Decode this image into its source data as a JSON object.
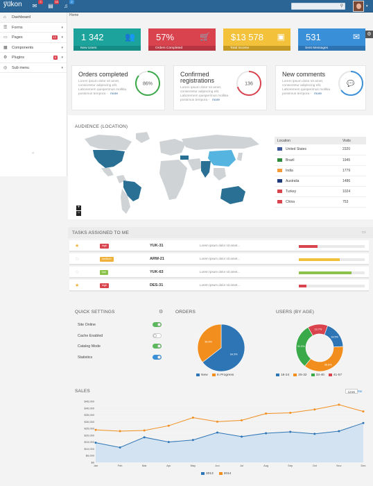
{
  "app": {
    "logo": "yukon",
    "logo_small": "admin"
  },
  "topbar": {
    "mail_badge": "3",
    "messages_badge": "18",
    "alerts_badge": "2"
  },
  "sidebar": {
    "items": [
      {
        "label": "Dashboard",
        "icon": "dashboard-icon"
      },
      {
        "label": "Forms",
        "icon": "forms-icon"
      },
      {
        "label": "Pages",
        "icon": "pages-icon",
        "badge": "12"
      },
      {
        "label": "Components",
        "icon": "components-icon"
      },
      {
        "label": "Plugins",
        "icon": "plugins-icon",
        "badge": "8"
      },
      {
        "label": "Sub menu",
        "icon": "submenu-icon"
      }
    ]
  },
  "breadcrumb": "Home",
  "stats": [
    {
      "value": "1 342",
      "label": "New Users",
      "color": "#1ba39c",
      "dark": "#168c86"
    },
    {
      "value": "57%",
      "label": "Orders Completed",
      "color": "#d9434e",
      "dark": "#b73540"
    },
    {
      "value": "$13 578",
      "label": "Total Income",
      "color": "#f3c13a",
      "dark": "#c59a24"
    },
    {
      "value": "531",
      "label": "Sent Messages",
      "color": "#3a8fd9",
      "dark": "#2e73b1"
    }
  ],
  "info_boxes": [
    {
      "title_1": "Orders completed",
      "title_2": "",
      "gauge": "86%",
      "percent": 86,
      "color": "#3aa94a",
      "desc_1": "Lorem ipsum dolor sit amet,",
      "desc_2": "consectetur adipiscing elit.",
      "desc_3": "Laboremem quisperimus mollitia",
      "desc_4": "possimus tempora -",
      "more": "more"
    },
    {
      "title_1": "Confirmed",
      "title_2": "registrations",
      "gauge": "136",
      "percent": 70,
      "color": "#d9434e",
      "desc_1": "Lorem ipsum dolor sit amet,",
      "desc_2": "consectetur adipiscing elit.",
      "desc_3": "Laboremem quisperimus mollitia",
      "desc_4": "possimus tempora -",
      "more": "more"
    },
    {
      "title_1": "New comments",
      "title_2": "",
      "gauge": "",
      "percent": 65,
      "color": "#3a8fd9",
      "desc_1": "Lorem ipsum dolor sit amet,",
      "desc_2": "consectetur adipiscing elit.",
      "desc_3": "Laboremem quisperimus mollitia",
      "desc_4": "possimus tempora -",
      "more": "more"
    }
  ],
  "audience": {
    "title": "AUDIENCE (LOCATION)",
    "col_location": "Location",
    "col_visits": "Visits",
    "rows": [
      {
        "country": "United States",
        "visits": "2320",
        "flag": "#3c5a99"
      },
      {
        "country": "Brazil",
        "visits": "1945",
        "flag": "#2e8b3c"
      },
      {
        "country": "India",
        "visits": "1779",
        "flag": "#f29b38"
      },
      {
        "country": "Australia",
        "visits": "1486",
        "flag": "#1f3a7a"
      },
      {
        "country": "Turkey",
        "visits": "1024",
        "flag": "#d9434e"
      },
      {
        "country": "China",
        "visits": "753",
        "flag": "#d9434e"
      }
    ],
    "zoom_in": "+",
    "zoom_out": "−"
  },
  "tasks": {
    "title": "TASKS ASSIGNED TO ME",
    "rows": [
      {
        "starred": true,
        "label": "high",
        "label_color": "#d9434e",
        "code": "YUK-31",
        "desc": "Lorem ipsum dolor sit amet...",
        "progress": 0.28,
        "bar_color": "#d9434e"
      },
      {
        "starred": false,
        "label": "medium",
        "label_color": "#f0b13a",
        "code": "ARW-21",
        "desc": "Lorem ipsum dolor sit amet...",
        "progress": 0.62,
        "bar_color": "#f0c03a"
      },
      {
        "starred": false,
        "label": "low",
        "label_color": "#8bc34a",
        "code": "YUK-63",
        "desc": "Lorem ipsum dolor sit amet...",
        "progress": 0.8,
        "bar_color": "#8bc34a"
      },
      {
        "starred": true,
        "label": "high",
        "label_color": "#d9434e",
        "code": "DES-31",
        "desc": "Lorem ipsum dolor sit amet...",
        "progress": 0.12,
        "bar_color": "#d9434e"
      }
    ]
  },
  "quick_settings": {
    "title": "QUICK SETTINGS",
    "items": [
      {
        "label": "Site Online",
        "on": true,
        "color": "#5cb85c"
      },
      {
        "label": "Cache Enabled",
        "on": false,
        "color": "#ffffff"
      },
      {
        "label": "Catalog Mode",
        "on": true,
        "color": "#5cb85c"
      },
      {
        "label": "Statistics",
        "on": true,
        "color": "#3a8fd9"
      }
    ]
  },
  "orders": {
    "title": "ORDERS"
  },
  "users_by_age": {
    "title": "USERS (BY AGE)"
  },
  "sales": {
    "title": "SALES",
    "btn_lines": "Lines",
    "btn_bars": "Bar"
  },
  "chart_data": [
    {
      "type": "pie",
      "title": "ORDERS",
      "categories": [
        "New",
        "In Progress"
      ],
      "values": [
        64.5,
        35.5
      ],
      "data_labels": [
        "64.5%",
        "35.5%"
      ],
      "colors": [
        "#2e75b6",
        "#f28e1e"
      ],
      "legend": "bottom"
    },
    {
      "type": "pie",
      "title": "USERS (BY AGE)",
      "categories": [
        "18-24",
        "25-32",
        "33-40",
        "41-57"
      ],
      "values": [
        18.5,
        36.8,
        31.0,
        13.7
      ],
      "data_labels": [
        "18.5%",
        "36.8%",
        "31.0%",
        "13.7%"
      ],
      "colors": [
        "#2e75b6",
        "#f28e1e",
        "#3aa94a",
        "#d9434e"
      ],
      "legend": "bottom"
    },
    {
      "type": "area",
      "title": "SALES",
      "categories": [
        "Jan",
        "Feb",
        "Mar",
        "Apr",
        "May",
        "Jun",
        "Jul",
        "Aug",
        "Sep",
        "Oct",
        "Nov",
        "Dec"
      ],
      "series": [
        {
          "name": "2013",
          "values": [
            14500,
            11000,
            18500,
            15000,
            16500,
            22000,
            19000,
            21500,
            22500,
            21000,
            23000,
            29000
          ],
          "color": "#2e75b6"
        },
        {
          "name": "2014",
          "values": [
            24000,
            23000,
            23500,
            27000,
            33000,
            30000,
            31000,
            36000,
            36500,
            39000,
            42500,
            37500
          ],
          "color": "#f28e1e"
        }
      ],
      "yticks": [
        "$0",
        "$5,000",
        "$10,000",
        "$15,000",
        "$20,000",
        "$25,000",
        "$30,000",
        "$35,000",
        "$40,000",
        "$45,000"
      ],
      "ylim": [
        0,
        45000
      ],
      "grid": true,
      "legend": "bottom"
    }
  ]
}
